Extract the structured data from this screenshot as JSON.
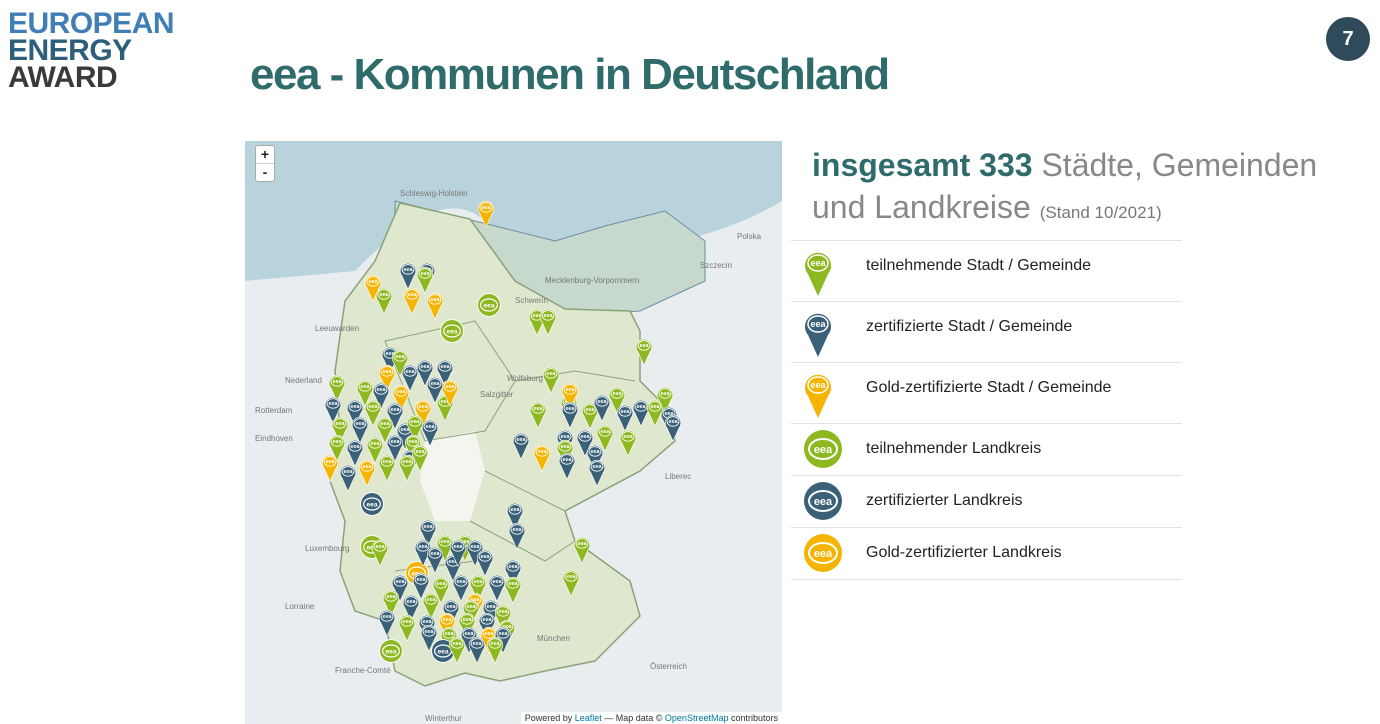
{
  "logo": {
    "line1": "EUROPEAN",
    "line2": "ENERGY",
    "line3": "AWARD"
  },
  "page_number": "7",
  "title": "eea - Kommunen in Deutschland",
  "summary": {
    "prefix": "insgesamt 333",
    "rest_line1": " Städte, Gemeinden",
    "line2": "und Landkreise",
    "stand": "(Stand 10/2021)"
  },
  "colors": {
    "participant": "#8db820",
    "certified": "#3b6178",
    "gold": "#f5b400",
    "title": "#2f6b6b"
  },
  "legend": [
    {
      "label": "teilnehmende Stadt / Gemeinde",
      "kind": "pin",
      "color": "#8db820"
    },
    {
      "label": "zertifizierte Stadt / Gemeinde",
      "kind": "pin",
      "color": "#3b6178"
    },
    {
      "label": "Gold-zertifizierte Stadt / Gemeinde",
      "kind": "pin",
      "color": "#f5b400"
    },
    {
      "label": "teilnehmender Landkreis",
      "kind": "circle",
      "color": "#8db820"
    },
    {
      "label": "zertifizierter Landkreis",
      "kind": "circle",
      "color": "#3b6178"
    },
    {
      "label": "Gold-zertifizierter Landkreis",
      "kind": "circle",
      "color": "#f5b400"
    }
  ],
  "marker_text": "eea",
  "map": {
    "zoom_in": "+",
    "zoom_out": "-",
    "attribution": {
      "prefix": "Powered by ",
      "leaflet": "Leaflet",
      "middle": " — Map data © ",
      "osm": "OpenStreetMap",
      "suffix": " contributors"
    },
    "place_labels": [
      "Schleswig-Holstein",
      "Schwerin",
      "Mecklenburg-Vorpommern",
      "Wolfsburg",
      "Rotterdam",
      "Eindhoven",
      "Luxembourg",
      "München",
      "Winterthur",
      "Szczecin",
      "Liberec",
      "Polska",
      "Nederland",
      "Lorraine",
      "Franche-Comté",
      "Österreich",
      "Leeuwarden",
      "Salzgitter"
    ]
  }
}
